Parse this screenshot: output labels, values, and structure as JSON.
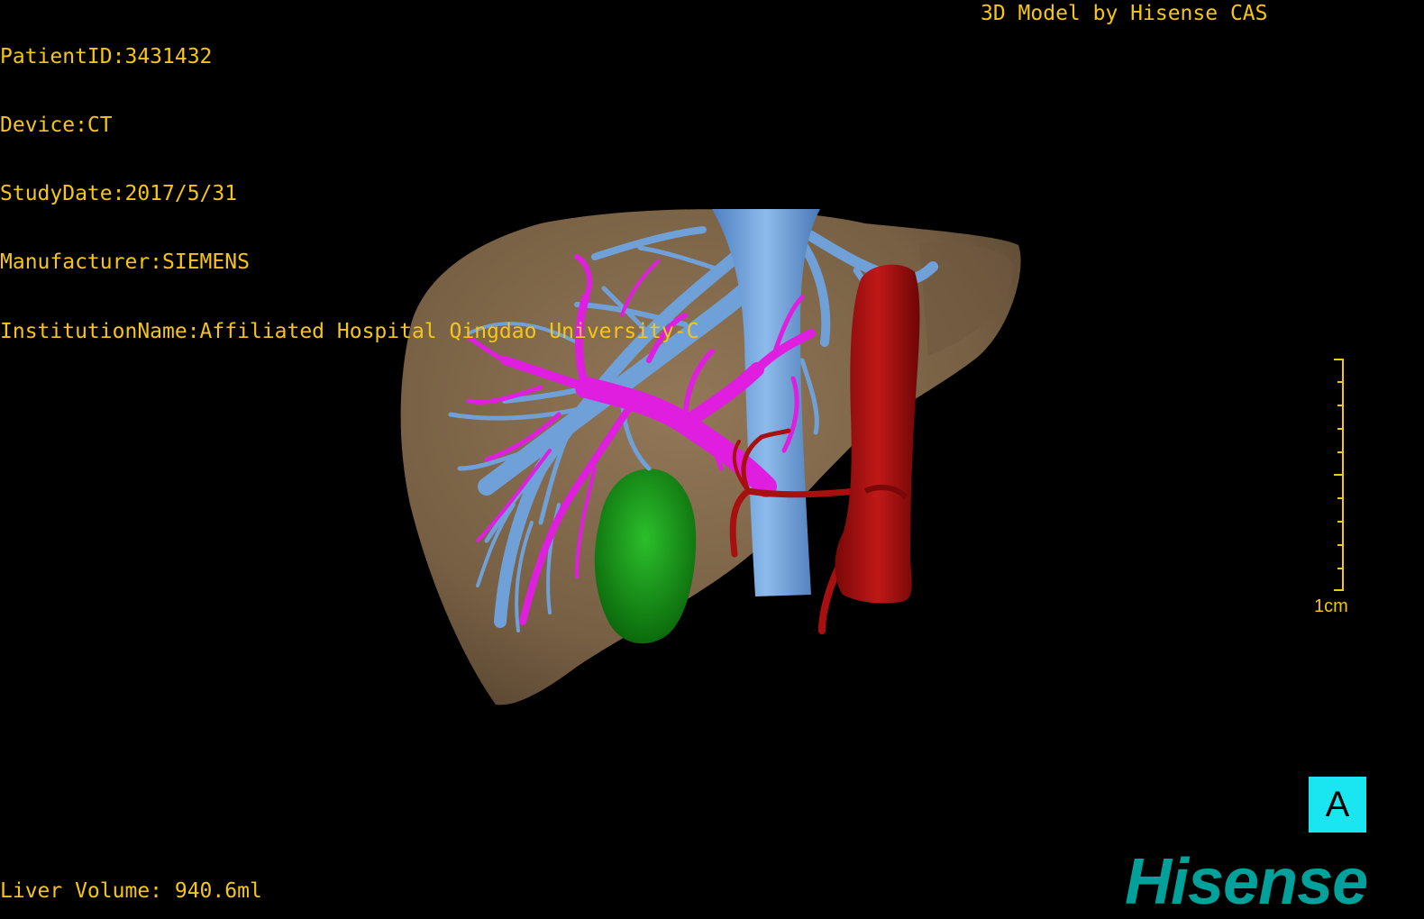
{
  "study_info": {
    "patient_id": "PatientID:3431432",
    "device": "Device:CT",
    "study_date": "StudyDate:2017/5/31",
    "manufacturer": "Manufacturer:SIEMENS",
    "institution": "InstitutionName:Affiliated Hospital Qingdao University-C"
  },
  "credit": "3D Model by Hisense CAS",
  "measurements": {
    "liver_volume": "Liver Volume: 940.6ml"
  },
  "scale": {
    "label": "1cm"
  },
  "view_button": {
    "label": "A"
  },
  "brand": {
    "logo": "Hisense"
  },
  "colors": {
    "overlay_text": "#f5c518",
    "liver": "#8a7052",
    "hepatic_vein": "#6fa0d8",
    "portal_vein": "#e01ee0",
    "artery": "#a81010",
    "gallbladder": "#1a9a1a",
    "view_button": "#19e6f0",
    "brand": "#00a19a"
  }
}
